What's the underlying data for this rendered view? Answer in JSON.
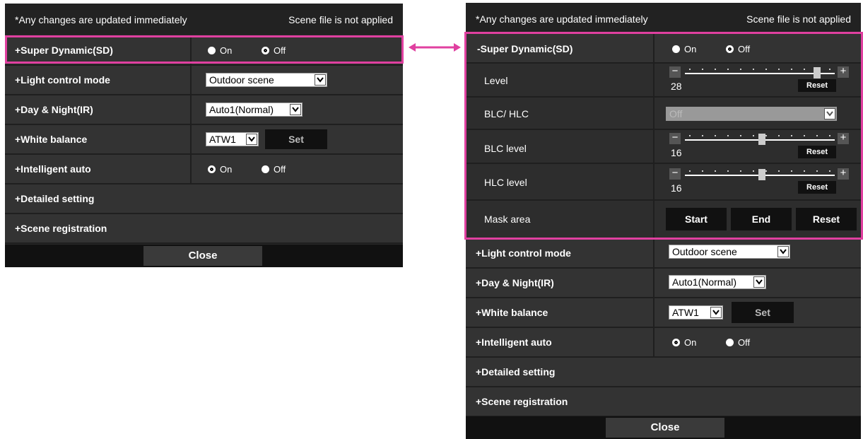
{
  "left": {
    "header": {
      "left": "*Any changes are updated immediately",
      "right": "Scene file is not applied"
    },
    "rows": {
      "sd": {
        "label": "+Super Dynamic(SD)",
        "on": "On",
        "off": "Off"
      },
      "light": {
        "label": "+Light control mode",
        "value": "Outdoor scene"
      },
      "day": {
        "label": "+Day & Night(IR)",
        "value": "Auto1(Normal)"
      },
      "wb": {
        "label": "+White balance",
        "value": "ATW1",
        "set": "Set"
      },
      "ia": {
        "label": "+Intelligent auto",
        "on": "On",
        "off": "Off"
      },
      "detail": {
        "label": "+Detailed setting"
      },
      "scene": {
        "label": "+Scene registration"
      }
    },
    "close": "Close"
  },
  "right": {
    "header": {
      "left": "*Any changes are updated immediately",
      "right": "Scene file is not applied"
    },
    "rows": {
      "sd": {
        "label": "-Super Dynamic(SD)",
        "on": "On",
        "off": "Off"
      },
      "level": {
        "label": "Level",
        "value": "28",
        "reset": "Reset",
        "fraction": 0.86
      },
      "blc": {
        "label": "BLC/ HLC",
        "value": "Off"
      },
      "blclevel": {
        "label": "BLC level",
        "value": "16",
        "reset": "Reset",
        "fraction": 0.5
      },
      "hlclevel": {
        "label": "HLC level",
        "value": "16",
        "reset": "Reset",
        "fraction": 0.5
      },
      "mask": {
        "label": "Mask area",
        "start": "Start",
        "end": "End",
        "reset": "Reset"
      },
      "light": {
        "label": "+Light control mode",
        "value": "Outdoor scene"
      },
      "day": {
        "label": "+Day & Night(IR)",
        "value": "Auto1(Normal)"
      },
      "wb": {
        "label": "+White balance",
        "value": "ATW1",
        "set": "Set"
      },
      "ia": {
        "label": "+Intelligent auto",
        "on": "On",
        "off": "Off"
      },
      "detail": {
        "label": "+Detailed setting"
      },
      "scene": {
        "label": "+Scene registration"
      }
    },
    "close": "Close"
  },
  "colors": {
    "highlight": "#e040a0",
    "panel": "#2a2a2a"
  }
}
